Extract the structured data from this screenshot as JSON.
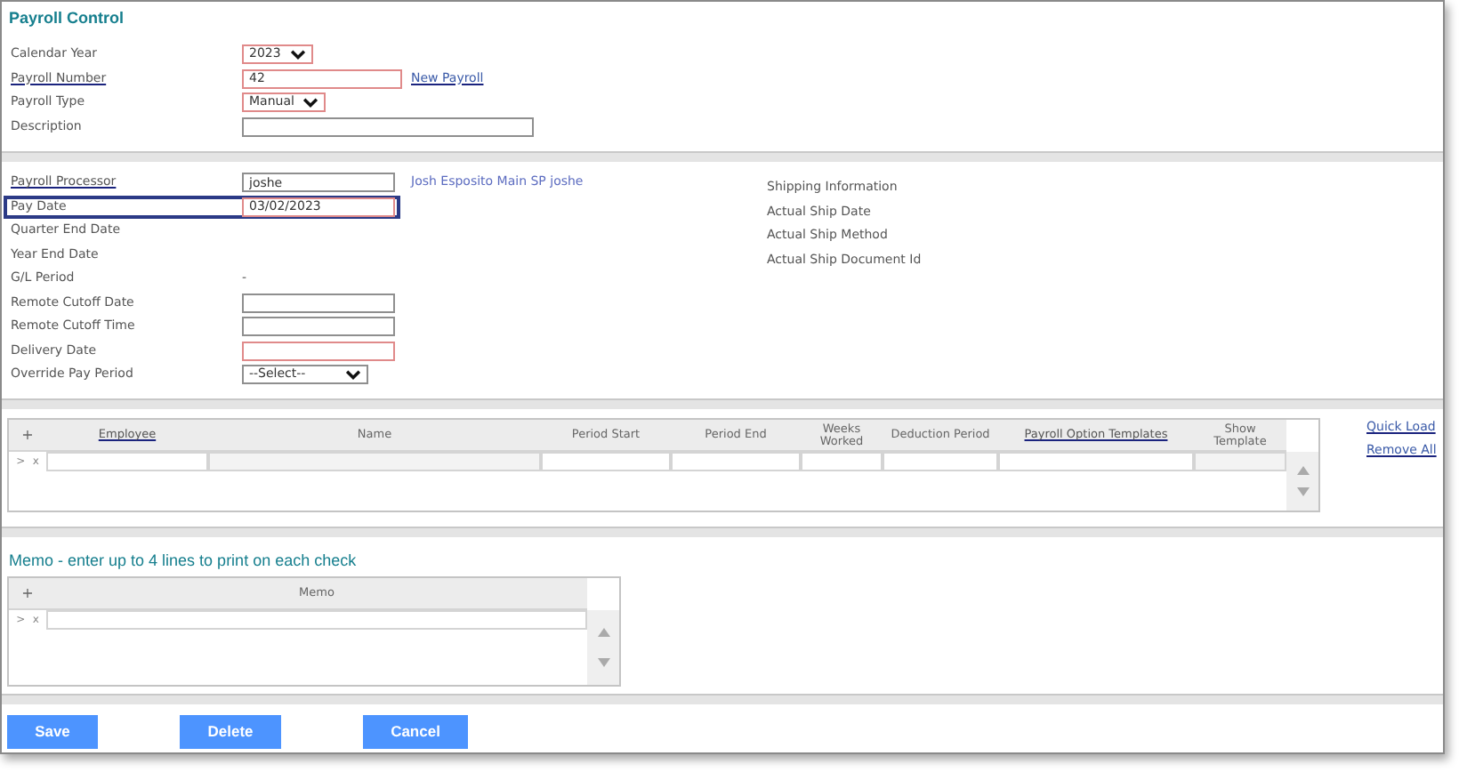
{
  "title": "Payroll Control",
  "header_fields": [
    {
      "label": "Calendar Year",
      "label_link": false,
      "kind": "select",
      "value": "2023",
      "required": true
    },
    {
      "label": "Payroll Number",
      "label_link": true,
      "kind": "text",
      "value": "42",
      "required": true,
      "link": "New Payroll"
    },
    {
      "label": "Payroll Type",
      "label_link": false,
      "kind": "select",
      "value": "Manual",
      "required": true
    },
    {
      "label": "Description",
      "label_link": false,
      "kind": "text",
      "required": false
    }
  ],
  "detail_fields": [
    {
      "label": "Payroll Processor",
      "label_link": true,
      "kind": "text",
      "value": "joshe",
      "required": false,
      "highlighted": false,
      "note": "Josh Esposito Main SP joshe"
    },
    {
      "label": "Pay Date",
      "label_link": false,
      "kind": "text",
      "value": "03/02/2023",
      "required": true,
      "highlighted": true
    },
    {
      "label": "Quarter End Date",
      "label_link": false,
      "kind": "none",
      "highlighted": false
    },
    {
      "label": "Year End Date",
      "label_link": false,
      "kind": "none",
      "highlighted": false
    },
    {
      "label": "G/L Period",
      "label_link": false,
      "kind": "static",
      "value": "-",
      "highlighted": false
    },
    {
      "label": "Remote Cutoff Date",
      "label_link": false,
      "kind": "text",
      "required": false,
      "highlighted": false
    },
    {
      "label": "Remote Cutoff Time",
      "label_link": false,
      "kind": "text",
      "required": false,
      "highlighted": false
    },
    {
      "label": "Delivery Date",
      "label_link": false,
      "kind": "text",
      "required": true,
      "highlighted": false
    },
    {
      "label": "Override Pay Period",
      "label_link": false,
      "kind": "select",
      "value": "--Select--",
      "required": false,
      "highlighted": false
    }
  ],
  "shipping": [
    "Shipping Information",
    "Actual Ship Date",
    "Actual Ship Method",
    "Actual Ship Document Id"
  ],
  "employee_grid": {
    "add": "+",
    "columns": [
      {
        "label": "Employee",
        "link": true,
        "readonly": false
      },
      {
        "label": "Name",
        "link": false,
        "readonly": true
      },
      {
        "label": "Period Start",
        "link": false,
        "readonly": false
      },
      {
        "label": "Period End",
        "link": false,
        "readonly": false
      },
      {
        "label": "Weeks Worked",
        "link": false,
        "readonly": false
      },
      {
        "label": "Deduction Period",
        "link": false,
        "readonly": false
      },
      {
        "label": "Payroll Option Templates",
        "link": true,
        "readonly": false
      },
      {
        "label": "Show Template",
        "link": false,
        "readonly": true
      }
    ],
    "row_marks": [
      ">",
      "x"
    ]
  },
  "grid_actions": [
    "Quick Load",
    "Remove All"
  ],
  "memo": {
    "title": "Memo - enter up to 4 lines to print on each check",
    "add": "+",
    "columns": [
      {
        "label": "Memo",
        "link": false,
        "readonly": false
      }
    ],
    "row_marks": [
      ">",
      "x"
    ]
  },
  "buttons": [
    "Save",
    "Delete",
    "Cancel"
  ]
}
